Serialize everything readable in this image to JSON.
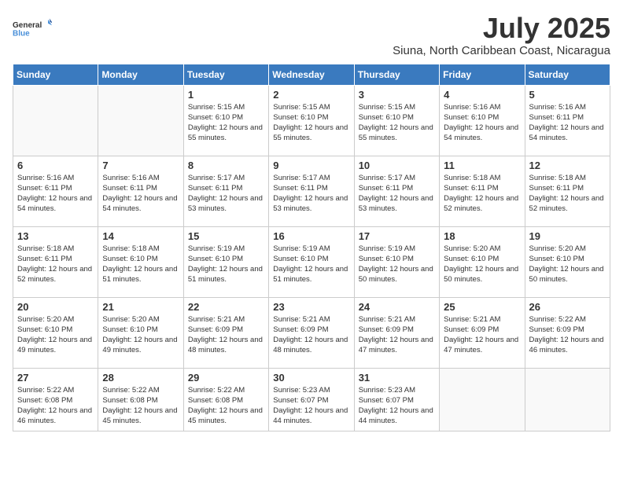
{
  "header": {
    "logo_general": "General",
    "logo_blue": "Blue",
    "month": "July 2025",
    "location": "Siuna, North Caribbean Coast, Nicaragua"
  },
  "days_of_week": [
    "Sunday",
    "Monday",
    "Tuesday",
    "Wednesday",
    "Thursday",
    "Friday",
    "Saturday"
  ],
  "weeks": [
    [
      {
        "day": "",
        "info": ""
      },
      {
        "day": "",
        "info": ""
      },
      {
        "day": "1",
        "info": "Sunrise: 5:15 AM\nSunset: 6:10 PM\nDaylight: 12 hours and 55 minutes."
      },
      {
        "day": "2",
        "info": "Sunrise: 5:15 AM\nSunset: 6:10 PM\nDaylight: 12 hours and 55 minutes."
      },
      {
        "day": "3",
        "info": "Sunrise: 5:15 AM\nSunset: 6:10 PM\nDaylight: 12 hours and 55 minutes."
      },
      {
        "day": "4",
        "info": "Sunrise: 5:16 AM\nSunset: 6:10 PM\nDaylight: 12 hours and 54 minutes."
      },
      {
        "day": "5",
        "info": "Sunrise: 5:16 AM\nSunset: 6:11 PM\nDaylight: 12 hours and 54 minutes."
      }
    ],
    [
      {
        "day": "6",
        "info": "Sunrise: 5:16 AM\nSunset: 6:11 PM\nDaylight: 12 hours and 54 minutes."
      },
      {
        "day": "7",
        "info": "Sunrise: 5:16 AM\nSunset: 6:11 PM\nDaylight: 12 hours and 54 minutes."
      },
      {
        "day": "8",
        "info": "Sunrise: 5:17 AM\nSunset: 6:11 PM\nDaylight: 12 hours and 53 minutes."
      },
      {
        "day": "9",
        "info": "Sunrise: 5:17 AM\nSunset: 6:11 PM\nDaylight: 12 hours and 53 minutes."
      },
      {
        "day": "10",
        "info": "Sunrise: 5:17 AM\nSunset: 6:11 PM\nDaylight: 12 hours and 53 minutes."
      },
      {
        "day": "11",
        "info": "Sunrise: 5:18 AM\nSunset: 6:11 PM\nDaylight: 12 hours and 52 minutes."
      },
      {
        "day": "12",
        "info": "Sunrise: 5:18 AM\nSunset: 6:11 PM\nDaylight: 12 hours and 52 minutes."
      }
    ],
    [
      {
        "day": "13",
        "info": "Sunrise: 5:18 AM\nSunset: 6:11 PM\nDaylight: 12 hours and 52 minutes."
      },
      {
        "day": "14",
        "info": "Sunrise: 5:18 AM\nSunset: 6:10 PM\nDaylight: 12 hours and 51 minutes."
      },
      {
        "day": "15",
        "info": "Sunrise: 5:19 AM\nSunset: 6:10 PM\nDaylight: 12 hours and 51 minutes."
      },
      {
        "day": "16",
        "info": "Sunrise: 5:19 AM\nSunset: 6:10 PM\nDaylight: 12 hours and 51 minutes."
      },
      {
        "day": "17",
        "info": "Sunrise: 5:19 AM\nSunset: 6:10 PM\nDaylight: 12 hours and 50 minutes."
      },
      {
        "day": "18",
        "info": "Sunrise: 5:20 AM\nSunset: 6:10 PM\nDaylight: 12 hours and 50 minutes."
      },
      {
        "day": "19",
        "info": "Sunrise: 5:20 AM\nSunset: 6:10 PM\nDaylight: 12 hours and 50 minutes."
      }
    ],
    [
      {
        "day": "20",
        "info": "Sunrise: 5:20 AM\nSunset: 6:10 PM\nDaylight: 12 hours and 49 minutes."
      },
      {
        "day": "21",
        "info": "Sunrise: 5:20 AM\nSunset: 6:10 PM\nDaylight: 12 hours and 49 minutes."
      },
      {
        "day": "22",
        "info": "Sunrise: 5:21 AM\nSunset: 6:09 PM\nDaylight: 12 hours and 48 minutes."
      },
      {
        "day": "23",
        "info": "Sunrise: 5:21 AM\nSunset: 6:09 PM\nDaylight: 12 hours and 48 minutes."
      },
      {
        "day": "24",
        "info": "Sunrise: 5:21 AM\nSunset: 6:09 PM\nDaylight: 12 hours and 47 minutes."
      },
      {
        "day": "25",
        "info": "Sunrise: 5:21 AM\nSunset: 6:09 PM\nDaylight: 12 hours and 47 minutes."
      },
      {
        "day": "26",
        "info": "Sunrise: 5:22 AM\nSunset: 6:09 PM\nDaylight: 12 hours and 46 minutes."
      }
    ],
    [
      {
        "day": "27",
        "info": "Sunrise: 5:22 AM\nSunset: 6:08 PM\nDaylight: 12 hours and 46 minutes."
      },
      {
        "day": "28",
        "info": "Sunrise: 5:22 AM\nSunset: 6:08 PM\nDaylight: 12 hours and 45 minutes."
      },
      {
        "day": "29",
        "info": "Sunrise: 5:22 AM\nSunset: 6:08 PM\nDaylight: 12 hours and 45 minutes."
      },
      {
        "day": "30",
        "info": "Sunrise: 5:23 AM\nSunset: 6:07 PM\nDaylight: 12 hours and 44 minutes."
      },
      {
        "day": "31",
        "info": "Sunrise: 5:23 AM\nSunset: 6:07 PM\nDaylight: 12 hours and 44 minutes."
      },
      {
        "day": "",
        "info": ""
      },
      {
        "day": "",
        "info": ""
      }
    ]
  ]
}
